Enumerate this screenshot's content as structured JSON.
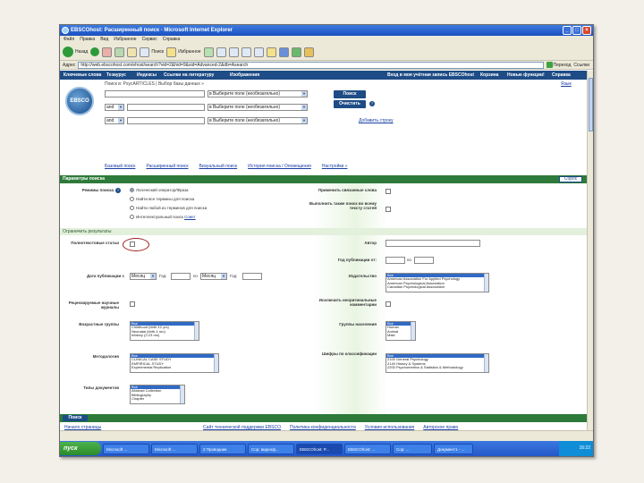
{
  "window": {
    "title": "EBSCOhost: Расширенный поиск - Microsoft Internet Explorer"
  },
  "menubar": [
    "Файл",
    "Правка",
    "Вид",
    "Избранное",
    "Сервис",
    "Справка"
  ],
  "toolbar": {
    "back": "Назад",
    "search": "Поиск",
    "favorites": "Избранное"
  },
  "address": {
    "label": "Адрес",
    "url": "http://web.ebscohost.com/ehost/search?vid=2&hid=9&sid=Advanced-2&db=Asearch",
    "go": "Переход",
    "links": "Ссылки"
  },
  "topnav": {
    "left": [
      "Ключевые слова",
      "Тезаурус",
      "Индексы",
      "Ссылки на литературу",
      "Изображения"
    ],
    "right": [
      "Вход в моя учётная запись EBSCOhost",
      "Корзина",
      "Новые функции!",
      "Справка"
    ],
    "lang": "Язык"
  },
  "search": {
    "label": "Поиск в: PsycARTICLES  |  Выбор базы данных »",
    "rows": [
      {
        "op": "",
        "field": "в  Выберите поле (необязательно)"
      },
      {
        "op": "and",
        "field": "в  Выберите поле (необязательно)"
      },
      {
        "op": "and",
        "field": "в  Выберите поле (необязательно)"
      }
    ],
    "search_btn": "Поиск",
    "clear_btn": "Очистить",
    "add_row": "Добавить строку"
  },
  "tabs": [
    "Базовый поиск",
    "Расширенный поиск",
    "Визуальный поиск",
    "История поиска / Оповещения",
    "Настройки »"
  ],
  "search_options": {
    "header": "Параметры поиска",
    "reset": "Сброс",
    "modes_label": "Режимы поиска",
    "modes": [
      "Логический оператор/Фраза",
      "Найти все термины для поиска",
      "Найти любой из терминов для поиска",
      "Интеллектуальный поиск"
    ],
    "smarttext_hint": "Совет",
    "related_label": "Применить связанные слова",
    "fulltext_label": "Выполнить также поиск во всему тексту статей"
  },
  "limits": {
    "header": "Ограничить результаты",
    "fulltext_label": "Полнотекстовые статьи",
    "author_label": "Автор",
    "pubyear_label": "Год публикации от:",
    "pubyear_to": "по",
    "pubdate_label": "Дата публикации с",
    "month_placeholder": "Месяц",
    "year_label": "Год:",
    "to_label": "по",
    "publisher_label": "Издательство",
    "publishers": [
      "Все",
      "American Association For Applied Psychology",
      "American Psychological Association",
      "Canadian Psychological Association"
    ],
    "peer_label": "Рецензируемые научные журналы",
    "exclude_label": "Исключить неоригинальные комментарии",
    "age_label": "Возрастные группы",
    "ages": [
      "Все",
      "Childhood (birth-12 yrs)",
      "Neonatal (birth-1 mo)",
      "Infancy (2-23 mo)"
    ],
    "pop_label": "Группы населения",
    "pops": [
      "Все",
      "Human",
      "Animal",
      "Male"
    ],
    "method_label": "Методология",
    "methods": [
      "Все",
      "CLINICAL CASE STUDY",
      "EMPIRICAL STUDY",
      "Experimental Replication"
    ],
    "class_label": "Шифры по классификации",
    "classes": [
      "Все",
      "2100 General Psychology",
      "2140 History & Systems",
      "2200 Psychometrics & Statistics & Methodology"
    ],
    "doc_label": "Типы документов",
    "docs": [
      "Все",
      "Abstract Collection",
      "Bibliography",
      "Chapter"
    ]
  },
  "footer": {
    "search_btn": "Поиск",
    "top_link": "Начало страницы",
    "links": [
      "Сайт технической поддержки EBSCO",
      "Политика конфиденциальности",
      "Условия использования",
      "Авторское право"
    ]
  },
  "taskbar": {
    "start": "пуск",
    "tasks": [
      "Microsoft ...",
      "Microsoft ...",
      "2 Проводник",
      "Сор: видеоф...",
      "EBSCOhost: P...",
      "EBSCOhost: ...",
      "Сор: ...",
      "Документ1 - ..."
    ],
    "clock": "16:22"
  }
}
